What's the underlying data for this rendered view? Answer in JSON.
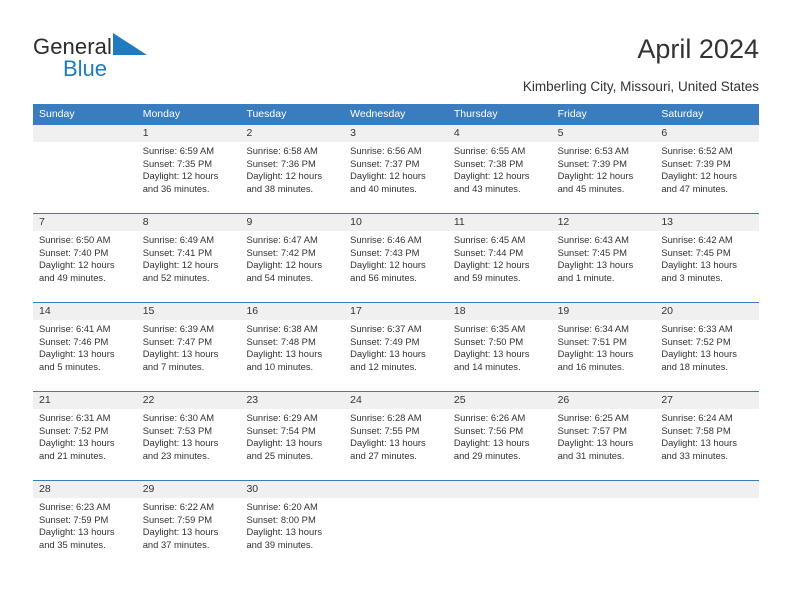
{
  "brand": {
    "name_part1": "General",
    "name_part2": "Blue",
    "triangle_color": "#1f7bc1"
  },
  "header": {
    "title": "April 2024",
    "subtitle": "Kimberling City, Missouri, United States"
  },
  "theme": {
    "header_blue": "#3a7dbf",
    "day_band_gray": "#f0f0f0",
    "text": "#333333"
  },
  "weekdays": [
    "Sunday",
    "Monday",
    "Tuesday",
    "Wednesday",
    "Thursday",
    "Friday",
    "Saturday"
  ],
  "weeks": [
    {
      "days": [
        {
          "num": "",
          "lines": []
        },
        {
          "num": "1",
          "lines": [
            "Sunrise: 6:59 AM",
            "Sunset: 7:35 PM",
            "Daylight: 12 hours",
            "and 36 minutes."
          ]
        },
        {
          "num": "2",
          "lines": [
            "Sunrise: 6:58 AM",
            "Sunset: 7:36 PM",
            "Daylight: 12 hours",
            "and 38 minutes."
          ]
        },
        {
          "num": "3",
          "lines": [
            "Sunrise: 6:56 AM",
            "Sunset: 7:37 PM",
            "Daylight: 12 hours",
            "and 40 minutes."
          ]
        },
        {
          "num": "4",
          "lines": [
            "Sunrise: 6:55 AM",
            "Sunset: 7:38 PM",
            "Daylight: 12 hours",
            "and 43 minutes."
          ]
        },
        {
          "num": "5",
          "lines": [
            "Sunrise: 6:53 AM",
            "Sunset: 7:39 PM",
            "Daylight: 12 hours",
            "and 45 minutes."
          ]
        },
        {
          "num": "6",
          "lines": [
            "Sunrise: 6:52 AM",
            "Sunset: 7:39 PM",
            "Daylight: 12 hours",
            "and 47 minutes."
          ]
        }
      ]
    },
    {
      "days": [
        {
          "num": "7",
          "lines": [
            "Sunrise: 6:50 AM",
            "Sunset: 7:40 PM",
            "Daylight: 12 hours",
            "and 49 minutes."
          ]
        },
        {
          "num": "8",
          "lines": [
            "Sunrise: 6:49 AM",
            "Sunset: 7:41 PM",
            "Daylight: 12 hours",
            "and 52 minutes."
          ]
        },
        {
          "num": "9",
          "lines": [
            "Sunrise: 6:47 AM",
            "Sunset: 7:42 PM",
            "Daylight: 12 hours",
            "and 54 minutes."
          ]
        },
        {
          "num": "10",
          "lines": [
            "Sunrise: 6:46 AM",
            "Sunset: 7:43 PM",
            "Daylight: 12 hours",
            "and 56 minutes."
          ]
        },
        {
          "num": "11",
          "lines": [
            "Sunrise: 6:45 AM",
            "Sunset: 7:44 PM",
            "Daylight: 12 hours",
            "and 59 minutes."
          ]
        },
        {
          "num": "12",
          "lines": [
            "Sunrise: 6:43 AM",
            "Sunset: 7:45 PM",
            "Daylight: 13 hours",
            "and 1 minute."
          ]
        },
        {
          "num": "13",
          "lines": [
            "Sunrise: 6:42 AM",
            "Sunset: 7:45 PM",
            "Daylight: 13 hours",
            "and 3 minutes."
          ]
        }
      ]
    },
    {
      "days": [
        {
          "num": "14",
          "lines": [
            "Sunrise: 6:41 AM",
            "Sunset: 7:46 PM",
            "Daylight: 13 hours",
            "and 5 minutes."
          ]
        },
        {
          "num": "15",
          "lines": [
            "Sunrise: 6:39 AM",
            "Sunset: 7:47 PM",
            "Daylight: 13 hours",
            "and 7 minutes."
          ]
        },
        {
          "num": "16",
          "lines": [
            "Sunrise: 6:38 AM",
            "Sunset: 7:48 PM",
            "Daylight: 13 hours",
            "and 10 minutes."
          ]
        },
        {
          "num": "17",
          "lines": [
            "Sunrise: 6:37 AM",
            "Sunset: 7:49 PM",
            "Daylight: 13 hours",
            "and 12 minutes."
          ]
        },
        {
          "num": "18",
          "lines": [
            "Sunrise: 6:35 AM",
            "Sunset: 7:50 PM",
            "Daylight: 13 hours",
            "and 14 minutes."
          ]
        },
        {
          "num": "19",
          "lines": [
            "Sunrise: 6:34 AM",
            "Sunset: 7:51 PM",
            "Daylight: 13 hours",
            "and 16 minutes."
          ]
        },
        {
          "num": "20",
          "lines": [
            "Sunrise: 6:33 AM",
            "Sunset: 7:52 PM",
            "Daylight: 13 hours",
            "and 18 minutes."
          ]
        }
      ]
    },
    {
      "days": [
        {
          "num": "21",
          "lines": [
            "Sunrise: 6:31 AM",
            "Sunset: 7:52 PM",
            "Daylight: 13 hours",
            "and 21 minutes."
          ]
        },
        {
          "num": "22",
          "lines": [
            "Sunrise: 6:30 AM",
            "Sunset: 7:53 PM",
            "Daylight: 13 hours",
            "and 23 minutes."
          ]
        },
        {
          "num": "23",
          "lines": [
            "Sunrise: 6:29 AM",
            "Sunset: 7:54 PM",
            "Daylight: 13 hours",
            "and 25 minutes."
          ]
        },
        {
          "num": "24",
          "lines": [
            "Sunrise: 6:28 AM",
            "Sunset: 7:55 PM",
            "Daylight: 13 hours",
            "and 27 minutes."
          ]
        },
        {
          "num": "25",
          "lines": [
            "Sunrise: 6:26 AM",
            "Sunset: 7:56 PM",
            "Daylight: 13 hours",
            "and 29 minutes."
          ]
        },
        {
          "num": "26",
          "lines": [
            "Sunrise: 6:25 AM",
            "Sunset: 7:57 PM",
            "Daylight: 13 hours",
            "and 31 minutes."
          ]
        },
        {
          "num": "27",
          "lines": [
            "Sunrise: 6:24 AM",
            "Sunset: 7:58 PM",
            "Daylight: 13 hours",
            "and 33 minutes."
          ]
        }
      ]
    },
    {
      "days": [
        {
          "num": "28",
          "lines": [
            "Sunrise: 6:23 AM",
            "Sunset: 7:59 PM",
            "Daylight: 13 hours",
            "and 35 minutes."
          ]
        },
        {
          "num": "29",
          "lines": [
            "Sunrise: 6:22 AM",
            "Sunset: 7:59 PM",
            "Daylight: 13 hours",
            "and 37 minutes."
          ]
        },
        {
          "num": "30",
          "lines": [
            "Sunrise: 6:20 AM",
            "Sunset: 8:00 PM",
            "Daylight: 13 hours",
            "and 39 minutes."
          ]
        },
        {
          "num": "",
          "lines": []
        },
        {
          "num": "",
          "lines": []
        },
        {
          "num": "",
          "lines": []
        },
        {
          "num": "",
          "lines": []
        }
      ]
    }
  ]
}
